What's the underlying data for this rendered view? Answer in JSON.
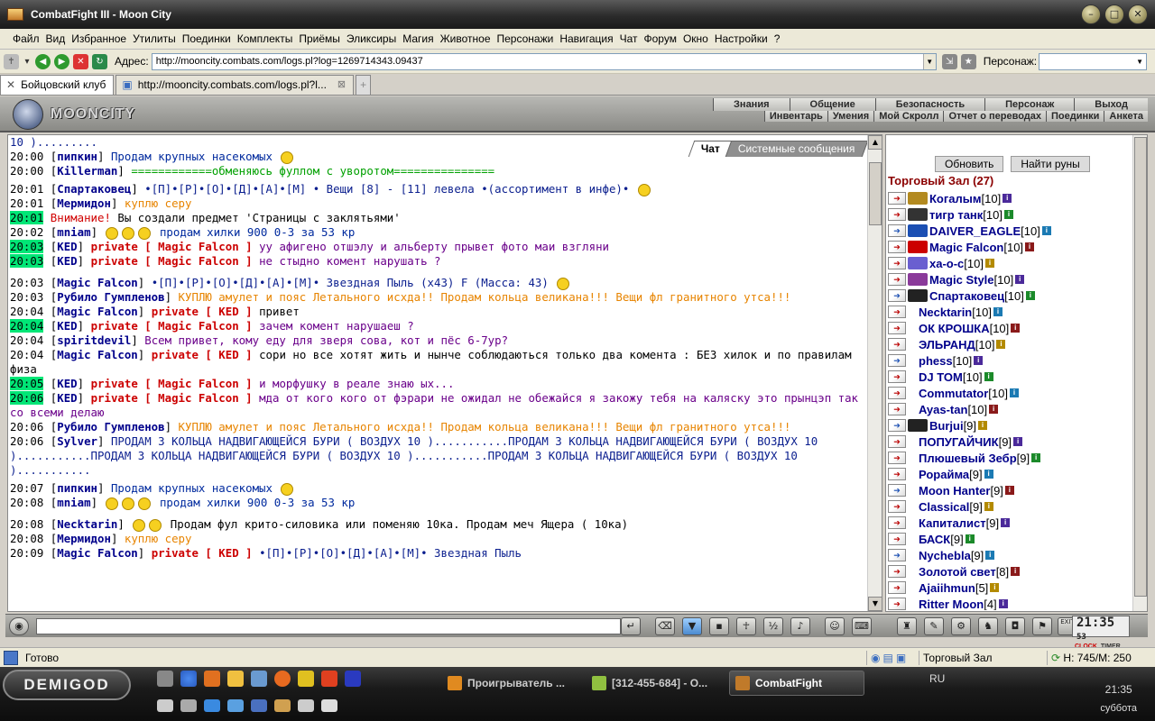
{
  "window": {
    "title": "CombatFight III - Moon City"
  },
  "menu": [
    "Файл",
    "Вид",
    "Избранное",
    "Утилиты",
    "Поединки",
    "Комплекты",
    "Приёмы",
    "Эликсиры",
    "Магия",
    "Животное",
    "Персонажи",
    "Навигация",
    "Чат",
    "Форум",
    "Окно",
    "Настройки",
    "?"
  ],
  "address": {
    "label": "Адрес:",
    "url": "http://mooncity.combats.com/logs.pl?log=1269714343.09437",
    "persona_label": "Персонаж:"
  },
  "tabs": [
    {
      "label": "Бойцовский клуб"
    },
    {
      "label": "http://mooncity.combats.com/logs.pl?l..."
    }
  ],
  "game": {
    "logo": "MOONCITY",
    "menu_top": [
      "Знания",
      "Общение",
      "Безопасность",
      "Персонаж",
      "Выход"
    ],
    "menu_bottom": [
      "Инвентарь",
      "Умения",
      "Мой Скролл",
      "Отчет о переводах",
      "Поединки",
      "Анкета"
    ]
  },
  "chat_tabs": [
    "Чат",
    "Системные сообщения"
  ],
  "chat": [
    {
      "time": "",
      "name": "",
      "private": "",
      "text": "10 ).........",
      "color": "m-navy",
      "smiles": 0
    },
    {
      "time": "20:00",
      "name": "пипкин",
      "private": "",
      "text": "Продам крупных насекомых",
      "color": "m-blue",
      "smiles": 1
    },
    {
      "time": "20:00",
      "name": "Killerman",
      "private": "",
      "text": "============обменяюсь фуллом с уворотом===============",
      "color": "m-green",
      "smiles": 0
    },
    {
      "time": "20:01",
      "name": "Спартаковец",
      "private": "",
      "text": "•[П]•[Р]•[О]•[Д]•[А]•[М] • Вещи [8] - [11] левела •(ассортимент в инфе)•",
      "color": "m-navy",
      "smiles": 1,
      "gap": true
    },
    {
      "time": "20:01",
      "name": "Мермидон",
      "private": "",
      "text": "куплю серу",
      "color": "m-orange",
      "smiles": 0
    },
    {
      "time": "20:01",
      "name": "",
      "private": "",
      "text": "Вы создали предмет 'Страницы с заклятьями'",
      "color": "m-black",
      "smiles": 0,
      "sys": "Внимание!",
      "hl": true
    },
    {
      "time": "20:02",
      "name": "mniam",
      "private": "",
      "text": "продам хилки 900 0-3 за 53 кр",
      "color": "m-blue",
      "smiles": 3
    },
    {
      "time": "20:03",
      "name": "KED",
      "private": "private [ Magic Falcon ]",
      "text": "уу афигено отшэлу и альберту прывет фото маи взгляни",
      "color": "m-purple",
      "smiles": 0,
      "hl": true
    },
    {
      "time": "20:03",
      "name": "KED",
      "private": "private [ Magic Falcon ]",
      "text": "не стыдно комент нарушать ?",
      "color": "m-purple",
      "smiles": 0,
      "hl": true
    },
    {
      "time": "20:03",
      "name": "Magic Falcon",
      "private": "",
      "text": "•[П]•[Р]•[О]•[Д]•[А]•[М]• Звездная Пыль (x43) F (Масса: 43)",
      "color": "m-navy",
      "smiles": 1,
      "big": true
    },
    {
      "time": "20:03",
      "name": "Рубило Гумпленов",
      "private": "",
      "text": "КУПЛЮ амулет и пояс Летального исхда!! Продам кольца великана!!! Вещи фл гранитного утса!!!",
      "color": "m-orange",
      "smiles": 0
    },
    {
      "time": "20:04",
      "name": "Magic Falcon",
      "private": "private [ KED ]",
      "text": "привет",
      "color": "m-black",
      "smiles": 0
    },
    {
      "time": "20:04",
      "name": "KED",
      "private": "private [ Magic Falcon ]",
      "text": "зачем комент нарушаеш ?",
      "color": "m-purple",
      "smiles": 0,
      "hl": true
    },
    {
      "time": "20:04",
      "name": "spiritdevil",
      "private": "",
      "text": "Всем привет, кому еду для зверя сова, кот и пёс 6-7ур?",
      "color": "m-purple",
      "smiles": 0
    },
    {
      "time": "20:04",
      "name": "Magic Falcon",
      "private": "private [ KED ]",
      "text": "сори но все хотят жить и нынче соблюдаються только два комента : БЕЗ хилок и по правилам физа",
      "color": "m-black",
      "smiles": 0
    },
    {
      "time": "20:05",
      "name": "KED",
      "private": "private [ Magic Falcon ]",
      "text": "и морфушку в реале знаю ых...",
      "color": "m-purple",
      "smiles": 0,
      "hl": true
    },
    {
      "time": "20:06",
      "name": "KED",
      "private": "private [ Magic Falcon ]",
      "text": "мда от кого кого от фэрари не ожидал не обежайся я закожу тебя на каляску это прынцэп так со всеми делаю",
      "color": "m-purple",
      "smiles": 0,
      "hl": true
    },
    {
      "time": "20:06",
      "name": "Рубило Гумпленов",
      "private": "",
      "text": "КУПЛЮ амулет и пояс Летального исхда!! Продам кольца великана!!! Вещи фл гранитного утса!!!",
      "color": "m-orange",
      "smiles": 0
    },
    {
      "time": "20:06",
      "name": "Sylver",
      "private": "",
      "text": "ПРОДАМ 3 КОЛЬЦА НАДВИГАЮЩЕЙСЯ БУРИ ( ВОЗДУХ 10 )...........ПРОДАМ 3 КОЛЬЦА НАДВИГАЮЩЕЙСЯ БУРИ ( ВОЗДУХ 10 )...........ПРОДАМ 3 КОЛЬЦА НАДВИГАЮЩЕЙСЯ БУРИ ( ВОЗДУХ 10 )...........ПРОДАМ 3 КОЛЬЦА НАДВИГАЮЩЕЙСЯ БУРИ ( ВОЗДУХ 10 )...........",
      "color": "m-navy",
      "smiles": 0
    },
    {
      "time": "20:07",
      "name": "пипкин",
      "private": "",
      "text": "Продам крупных насекомых",
      "color": "m-blue",
      "smiles": 1,
      "gap": true
    },
    {
      "time": "20:08",
      "name": "mniam",
      "private": "",
      "text": "продам хилки 900 0-3 за 53 кр",
      "color": "m-blue",
      "smiles": 3
    },
    {
      "time": "20:08",
      "name": "Necktarin",
      "private": "",
      "text": "Продам фул крито-силовика или поменяю 10ка. Продам меч Ящера ( 10ка)",
      "color": "m-black",
      "smiles": 2,
      "big": true
    },
    {
      "time": "20:08",
      "name": "Мермидон",
      "private": "",
      "text": "куплю серу",
      "color": "m-orange",
      "smiles": 0
    },
    {
      "time": "20:09",
      "name": "Magic Falcon",
      "private": "private [ KED ]",
      "text": "•[П]•[Р]•[О]•[Д]•[А]•[М]• Звездная Пыль",
      "color": "m-navy",
      "smiles": 0
    }
  ],
  "side": {
    "refresh_label": "Обновить",
    "runes_label": "Найти руны",
    "room_title": "Торговый Зал (27)",
    "users": [
      {
        "name": "Когалым",
        "level": "[10]",
        "clan": true
      },
      {
        "name": "тигр танк",
        "level": "[10]",
        "clan": true
      },
      {
        "name": "DAIVER_EAGLE",
        "level": "[10]",
        "clan": true
      },
      {
        "name": "Magic Falcon",
        "level": "[10]",
        "clan": true
      },
      {
        "name": "ха-о-с",
        "level": "[10]",
        "clan": true
      },
      {
        "name": "Magic Style",
        "level": "[10]",
        "clan": true
      },
      {
        "name": "Спартаковец",
        "level": "[10]",
        "clan": true
      },
      {
        "name": "Necktarin",
        "level": "[10]",
        "clan": false
      },
      {
        "name": "ОК КРОШКА",
        "level": "[10]",
        "clan": false
      },
      {
        "name": "ЭЛЬРАНД",
        "level": "[10]",
        "clan": false
      },
      {
        "name": "phess",
        "level": "[10]",
        "clan": false
      },
      {
        "name": "DJ TOM",
        "level": "[10]",
        "clan": false
      },
      {
        "name": "Commutator",
        "level": "[10]",
        "clan": false
      },
      {
        "name": "Ayas-tan",
        "level": "[10]",
        "clan": false
      },
      {
        "name": "Burjui",
        "level": "[9]",
        "clan": true
      },
      {
        "name": "ПОПУГАЙЧИК",
        "level": "[9]",
        "clan": false
      },
      {
        "name": "Плюшевый Зебр",
        "level": "[9]",
        "clan": false
      },
      {
        "name": "Рорайма",
        "level": "[9]",
        "clan": false
      },
      {
        "name": "Moon Hanter",
        "level": "[9]",
        "clan": false
      },
      {
        "name": "Classical",
        "level": "[9]",
        "clan": false
      },
      {
        "name": "Капиталист",
        "level": "[9]",
        "clan": false
      },
      {
        "name": "БАСК",
        "level": "[9]",
        "clan": false
      },
      {
        "name": "Nychebla",
        "level": "[9]",
        "clan": false
      },
      {
        "name": "Золотой свет",
        "level": "[8]",
        "clan": false
      },
      {
        "name": "Ajaiihmun",
        "level": "[5]",
        "clan": false
      },
      {
        "name": "Ritter Moon",
        "level": "[4]",
        "clan": false
      }
    ]
  },
  "clock": {
    "time": "21:35",
    "seconds": "53",
    "clock_label": "CLOCK",
    "timer_label": "TIMER",
    "exit_label": "EXIT"
  },
  "status": {
    "ready": "Готово",
    "room": "Торговый Зал",
    "hp": "Н: 745/М: 250"
  },
  "taskbar": {
    "start": "DEMIGOD",
    "tasks": [
      "Проигрыватель ...",
      "[312-455-684] - О...",
      "CombatFight"
    ],
    "lang": "RU",
    "time": "21:35",
    "day": "суббота"
  }
}
